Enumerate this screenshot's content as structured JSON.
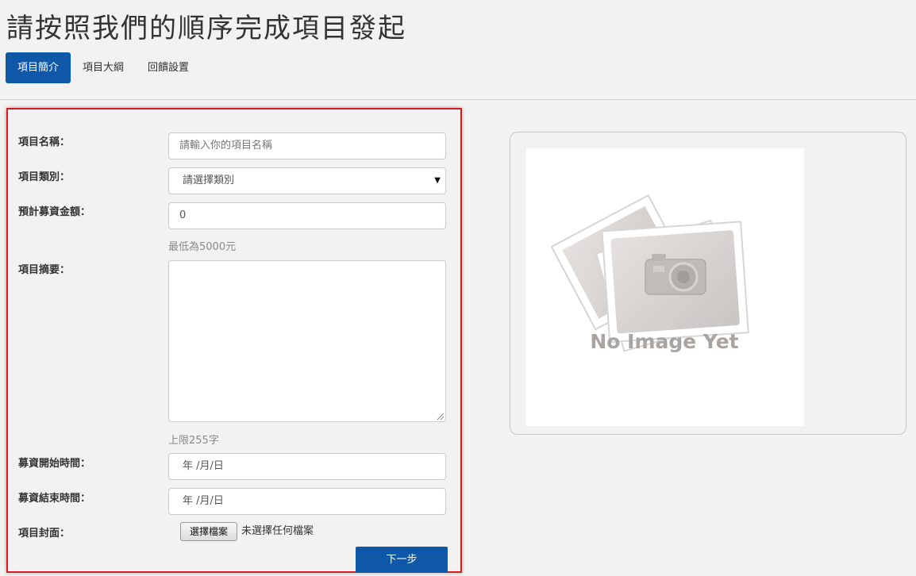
{
  "page": {
    "title": "請按照我們的順序完成項目發起"
  },
  "tabs": [
    {
      "label": "項目簡介",
      "active": true
    },
    {
      "label": "項目大綱",
      "active": false
    },
    {
      "label": "回饋設置",
      "active": false
    }
  ],
  "form": {
    "name": {
      "label": "項目名稱：",
      "placeholder": "請輸入你的項目名稱"
    },
    "category": {
      "label": "項目類別：",
      "selected": "請選擇類別"
    },
    "goal": {
      "label": "預計募資金額：",
      "value": "0",
      "help": "最低為5000元"
    },
    "summary": {
      "label": "項目摘要：",
      "value": "",
      "help": "上限255字"
    },
    "start_date": {
      "label": "募資開始時間：",
      "value": "年 /月/日"
    },
    "end_date": {
      "label": "募資結束時間：",
      "value": "年 /月/日"
    },
    "cover": {
      "label": "項目封面：",
      "button": "選擇檔案",
      "status": "未選擇任何檔案"
    },
    "next_button": "下一步"
  },
  "preview": {
    "image_text": "No Image Yet"
  },
  "colors": {
    "accent": "#0f58a8",
    "panel_border": "#d11f1f"
  },
  "icons": {
    "select": "caret-down-icon",
    "preview": "camera-icon"
  }
}
